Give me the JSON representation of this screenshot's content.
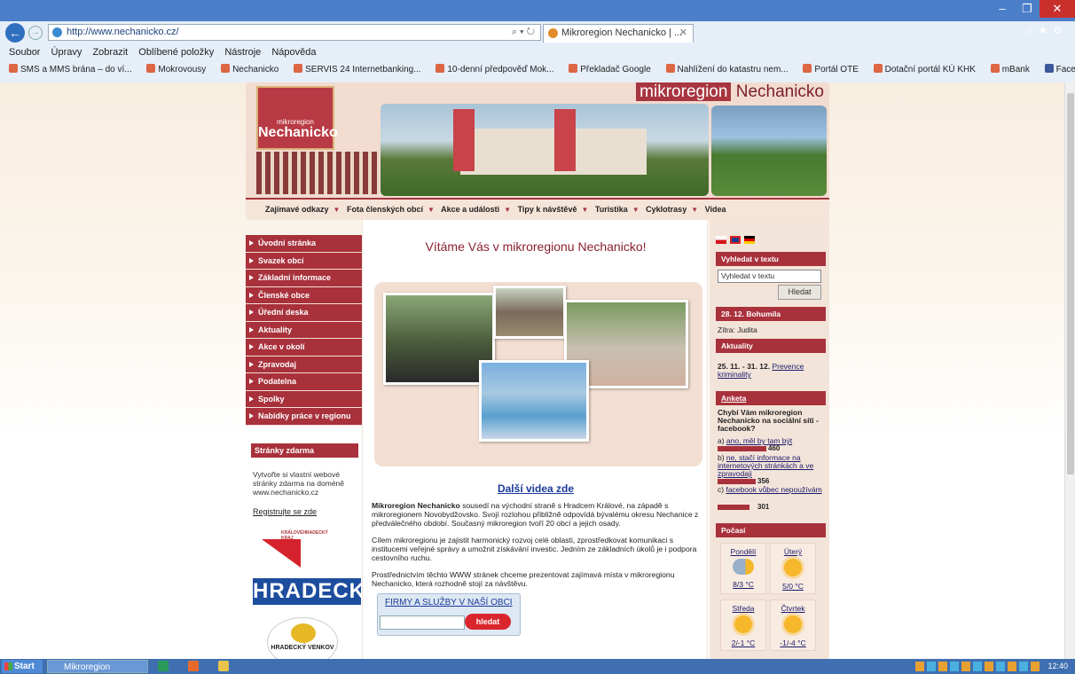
{
  "browser": {
    "url": "http://www.nechanicko.cz/",
    "tab_title": "Mikroregion Nechanicko | ...",
    "menu": [
      "Soubor",
      "Úpravy",
      "Zobrazit",
      "Oblíbené položky",
      "Nástroje",
      "Nápověda"
    ],
    "favorites": [
      "SMS a MMS brána – do ví...",
      "Mokrovousy",
      "Nechanicko",
      "SERVIS 24 Internetbanking...",
      "10-denní předpověď Mok...",
      "Překladač Google",
      "Nahlížení do katastru nem...",
      "Portál OTE",
      "Dotační portál KÚ KHK",
      "mBank",
      "Facebook"
    ]
  },
  "header": {
    "site_title_a": "mikroregion",
    "site_title_b": "Nechanicko",
    "logo_small": "mikroregion",
    "logo_big": "Nechanicko",
    "topnav": [
      "Zajímavé odkazy",
      "Fota členských obcí",
      "Akce a události",
      "Tipy k návštěvě",
      "Turistika",
      "Cyklotrasy",
      "Videa"
    ]
  },
  "leftnav": {
    "items": [
      "Úvodní stránka",
      "Svazek obcí",
      "Základní informace",
      "Členské obce",
      "Úřední deska",
      "Aktuality",
      "Akce v okolí",
      "Zpravodaj",
      "Podatelna",
      "Spolky",
      "Nabídky práce v regionu"
    ],
    "stranky_title": "Stránky zdarma",
    "stranky_text": "Vytvořte si vlastní webové stránky zdarma na doméně www.nechanicko.cz",
    "register_link": "Registrujte se zde",
    "kraj_text": "KRÁLOVÉHRADECKÝ KRAJ",
    "hradecku_text": "HRADECKU",
    "venkov_text": "HRADECKÝ VENKOV"
  },
  "main": {
    "welcome": "Vítáme Vás v mikroregionu Nechanicko!",
    "videos_link": "Další videa zde",
    "intro_bold": "Mikroregion Nechanicko",
    "intro_rest": " sousedí na východní straně s Hradcem Králové, na západě s mikroregionem Novobydžovsko. Svojí rozlohou přibližně odpovídá bývalému okresu Nechanice z předválečného období. Současný mikroregion tvoří 20 obcí a jejich osady.",
    "para2": "Cílem mikroregionu je zajistit harmonický rozvoj celé oblasti, zprostředkovat komunikaci s institucemi veřejné správy a umožnit získávání investic. Jedním ze základních úkolů je i podpora cestovního ruchu.",
    "para3": "Prostřednictvím těchto WWW stránek chceme prezentovat zajímavá místa v mikroregionu Nechanicko, která rozhodně stojí za návštěvu.",
    "firmy_title": "FIRMY A SLUŽBY V NAŠÍ OBCI",
    "firmy_button": "hledat"
  },
  "right": {
    "search_title": "Vyhledat v textu",
    "search_value": "Vyhledat v textu",
    "search_button": "Hledat",
    "nameday_title": "28. 12. Bohumila",
    "tomorrow": "Zítra: Judita",
    "news_title": "Aktuality",
    "news_date": "25. 11. - 31. 12.",
    "news_link": "Prevence kriminality",
    "poll_title": "Anketa",
    "poll_question": "Chybí Vám mikroregion Nechanicko na sociální síti - facebook?",
    "poll_a_prefix": "a) ",
    "poll_a": "ano, měl by tam být",
    "poll_a_votes": "460",
    "poll_b_prefix": "b) ",
    "poll_b": "ne, stačí informace na internetových stránkách a ve zpravodaji",
    "poll_b_votes": "356",
    "poll_c_prefix": "c) ",
    "poll_c": "facebook vůbec nepoužívám",
    "poll_c_votes": "301",
    "weather_title": "Počasí",
    "weather": [
      {
        "day": "Pondělí",
        "temp": "8/3 °C",
        "icon": "cloud-sun-icon"
      },
      {
        "day": "Úterý",
        "temp": "5/0 °C",
        "icon": "sun-icon"
      },
      {
        "day": "Středa",
        "temp": "2/-1 °C",
        "icon": "sun-icon"
      },
      {
        "day": "Čtvrtek",
        "temp": "-1/-4 °C",
        "icon": "sun-icon"
      }
    ]
  },
  "taskbar": {
    "start": "Start",
    "task": "Mikroregion Nechan...",
    "clock": "12:40"
  },
  "colors": {
    "brand": "#a8313b",
    "link": "#1a3a9a"
  }
}
